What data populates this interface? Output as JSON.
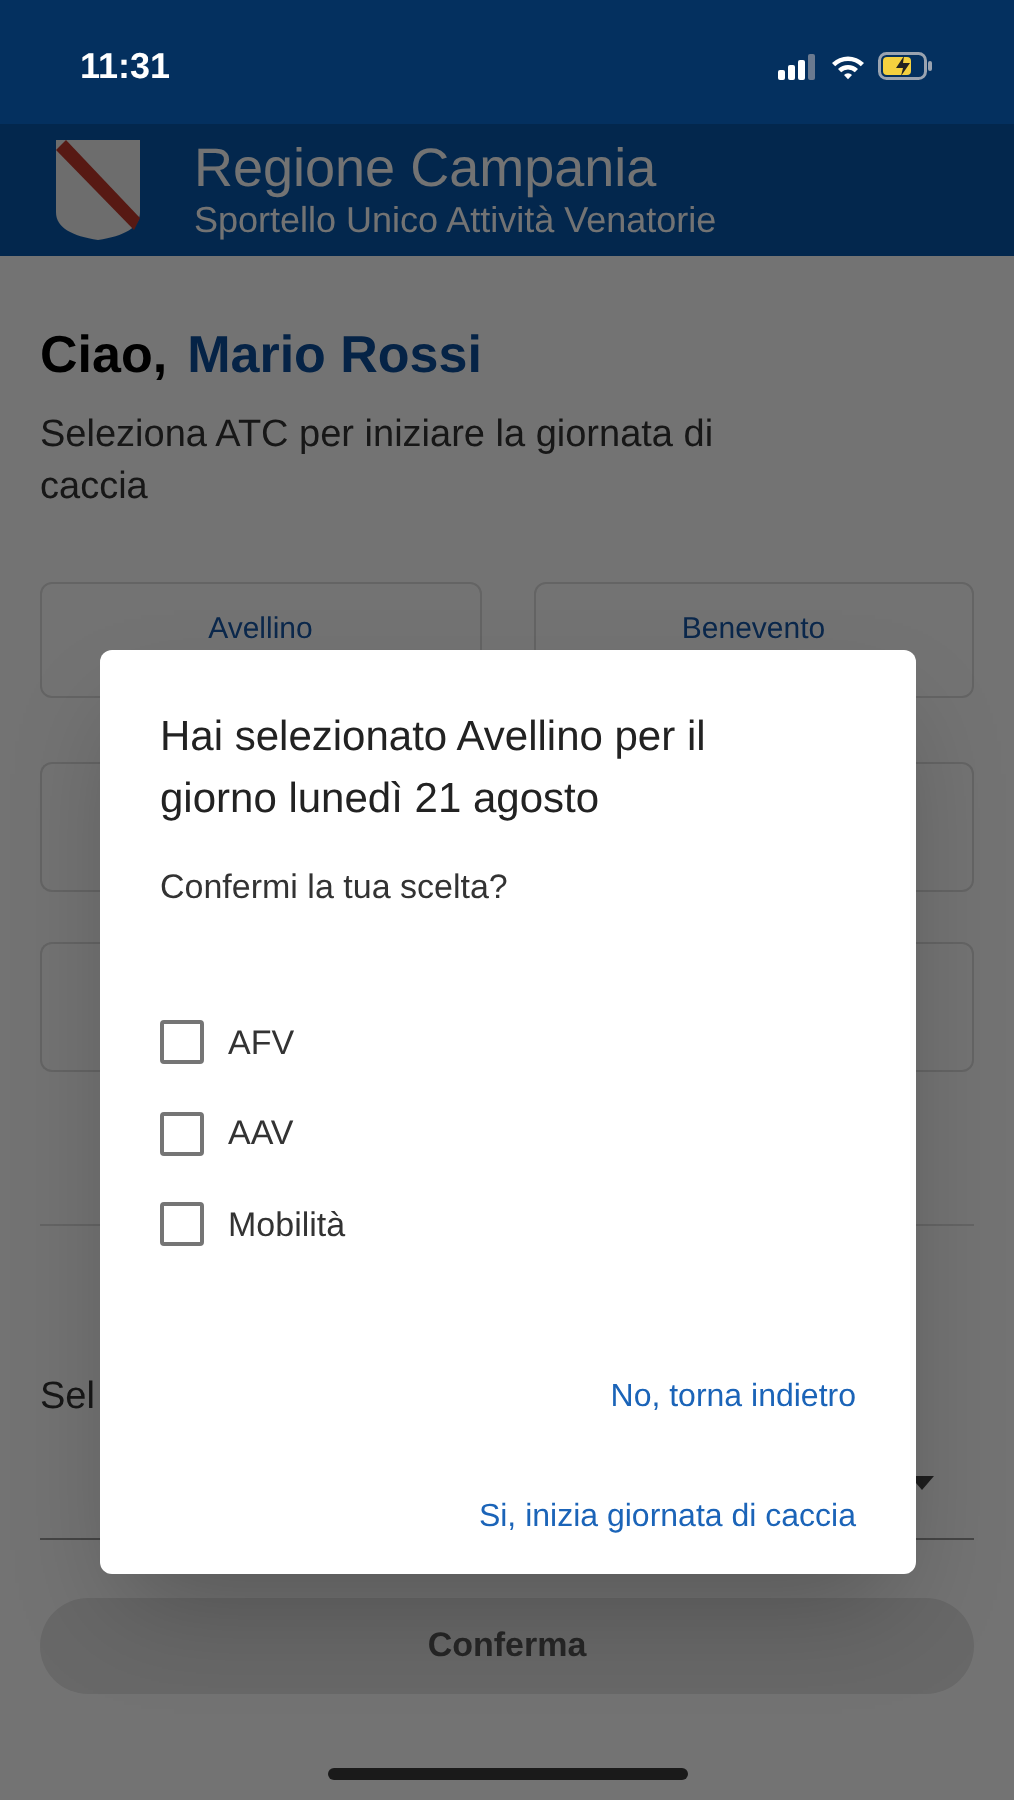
{
  "status_bar": {
    "time": "11:31"
  },
  "header": {
    "title": "Regione Campania",
    "subtitle": "Sportello Unico Attività Venatorie"
  },
  "greeting": {
    "label": "Ciao,",
    "name": "Mario Rossi"
  },
  "instruction": "Seleziona ATC per iniziare la giornata di caccia",
  "atc_cards": [
    {
      "label": "Avellino"
    },
    {
      "label": "Benevento"
    }
  ],
  "select_field": {
    "label": "Sel"
  },
  "confirm_button": {
    "label": "Conferma",
    "disabled": true
  },
  "dialog": {
    "title": "Hai selezionato Avellino per il giorno lunedì 21 agosto",
    "question": "Confermi la tua scelta?",
    "options": [
      {
        "label": "AFV",
        "checked": false
      },
      {
        "label": "AAV",
        "checked": false
      },
      {
        "label": "Mobilità",
        "checked": false
      }
    ],
    "actions": [
      {
        "label": "No, torna indietro"
      },
      {
        "label": "Si, inizia giornata di caccia"
      }
    ]
  }
}
